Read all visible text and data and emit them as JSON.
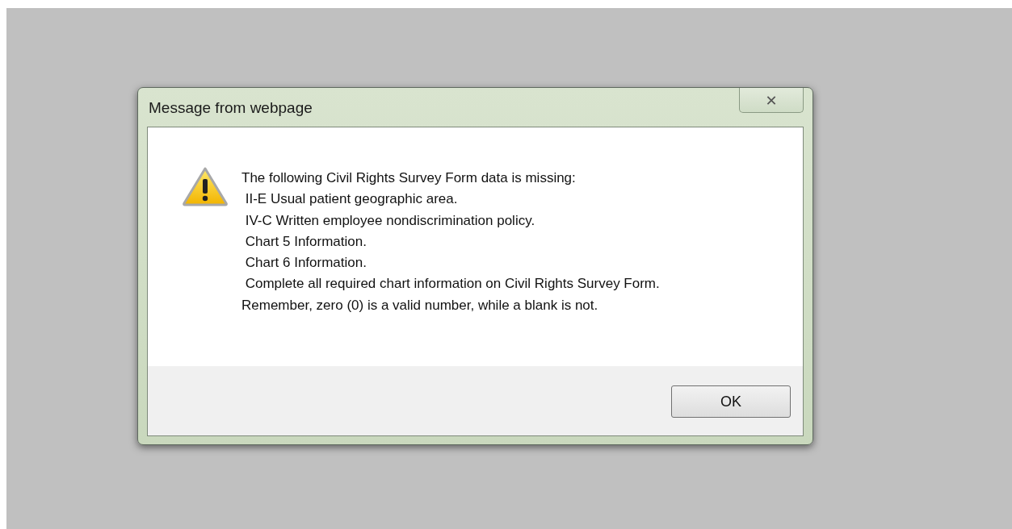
{
  "window": {
    "title": "Message from webpage",
    "close_label": "✕"
  },
  "message": {
    "lines": [
      "The following Civil Rights Survey Form data is missing:",
      " II-E Usual patient geographic area.",
      " IV-C Written employee nondiscrimination policy.",
      " Chart 5 Information.",
      " Chart 6 Information.",
      " Complete all required chart information on Civil Rights Survey Form.",
      "Remember, zero (0) is a valid number, while a blank is not."
    ]
  },
  "buttons": [
    "OK"
  ]
}
